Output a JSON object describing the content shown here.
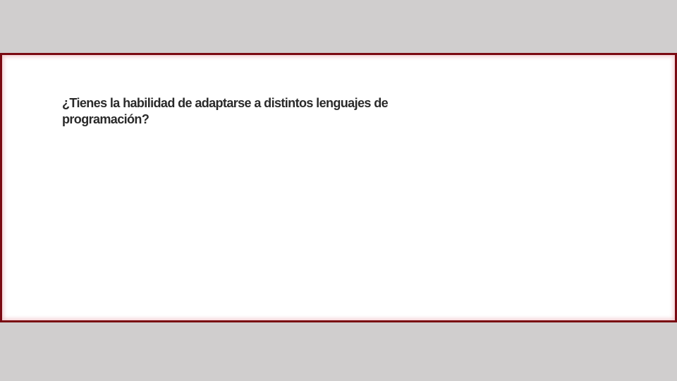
{
  "slide": {
    "question": "¿Tienes la habilidad de adaptarse a distintos lenguajes de programación?"
  },
  "colors": {
    "background": "#d0cece",
    "panel": "#ffffff",
    "panel_border": "#7a0a12",
    "text": "#2a2a2a"
  }
}
